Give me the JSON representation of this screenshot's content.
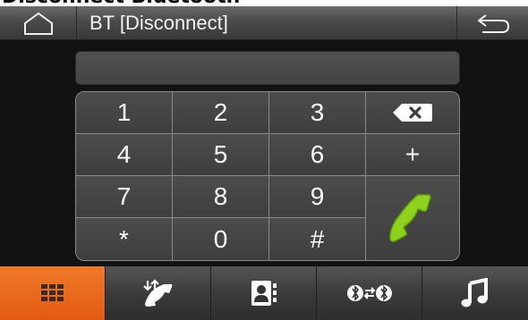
{
  "caption": "Disconnect Bluetooth",
  "header": {
    "home_icon": "home-icon",
    "title": "BT [Disconnect]",
    "back_icon": "back-arrow-icon"
  },
  "display": {
    "number": ""
  },
  "keypad": {
    "keys": [
      "1",
      "2",
      "3",
      "4",
      "5",
      "6",
      "7",
      "8",
      "9",
      "*",
      "0",
      "#"
    ],
    "backspace_icon": "backspace-icon",
    "plus": "+",
    "call_icon": "phone-call-icon"
  },
  "bottom_tabs": [
    {
      "icon": "dialpad-icon",
      "active": true
    },
    {
      "icon": "call-log-icon",
      "active": false
    },
    {
      "icon": "contacts-icon",
      "active": false
    },
    {
      "icon": "bluetooth-pair-icon",
      "active": false
    },
    {
      "icon": "music-icon",
      "active": false
    }
  ],
  "colors": {
    "accent": "#e8661a",
    "call_green": "#8ed21e",
    "background": "#121212"
  }
}
